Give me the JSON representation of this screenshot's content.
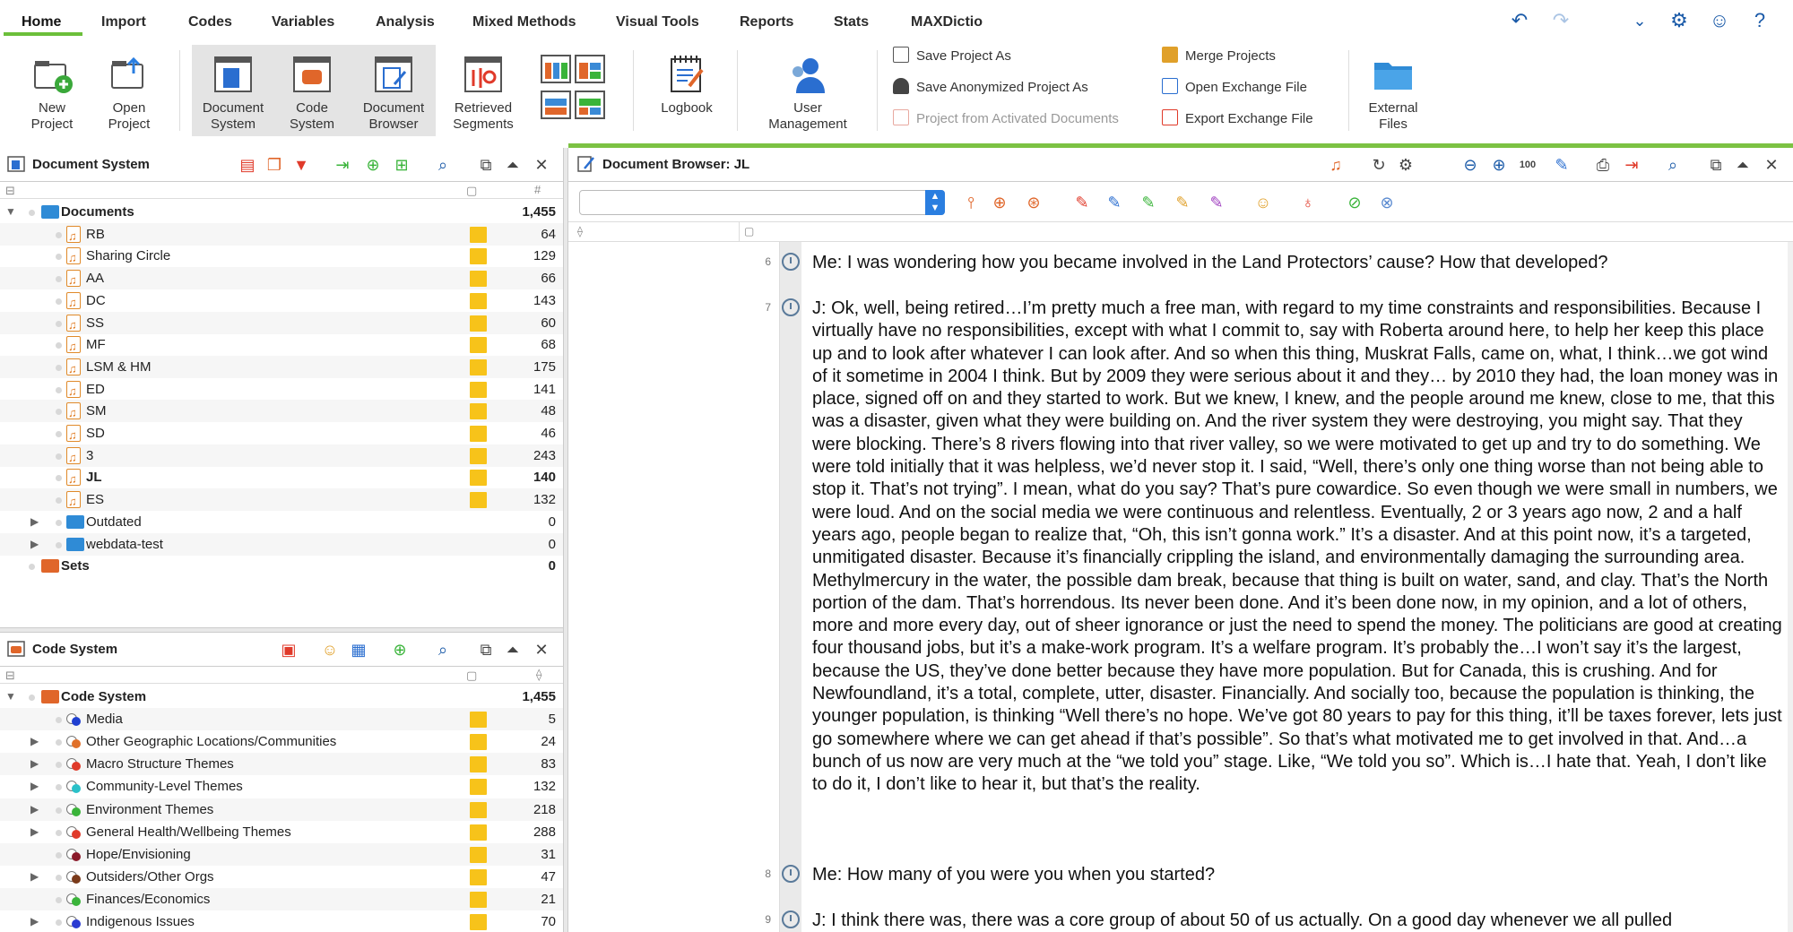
{
  "menu": {
    "tabs": [
      "Home",
      "Import",
      "Codes",
      "Variables",
      "Analysis",
      "Mixed Methods",
      "Visual Tools",
      "Reports",
      "Stats",
      "MAXDictio"
    ],
    "active": "Home"
  },
  "ribbon": {
    "new_project": "New\nProject",
    "open_project": "Open\nProject",
    "document_system": "Document\nSystem",
    "code_system": "Code\nSystem",
    "document_browser": "Document\nBrowser",
    "retrieved_segments": "Retrieved\nSegments",
    "logbook": "Logbook",
    "user_management": "User\nManagement",
    "save_project_as": "Save Project As",
    "save_anonymized": "Save Anonymized Project As",
    "project_from_activated": "Project from Activated Documents",
    "merge_projects": "Merge Projects",
    "open_exchange": "Open Exchange File",
    "export_exchange": "Export Exchange File",
    "external_files": "External\nFiles"
  },
  "document_system": {
    "title": "Document System",
    "col_count": "#",
    "root": {
      "label": "Documents",
      "count": "1,455"
    },
    "documents": [
      {
        "label": "RB",
        "count": "64"
      },
      {
        "label": "Sharing Circle",
        "count": "129"
      },
      {
        "label": "AA",
        "count": "66"
      },
      {
        "label": "DC",
        "count": "143"
      },
      {
        "label": "SS",
        "count": "60"
      },
      {
        "label": "MF",
        "count": "68"
      },
      {
        "label": "LSM & HM",
        "count": "175"
      },
      {
        "label": "ED",
        "count": "141"
      },
      {
        "label": "SM",
        "count": "48"
      },
      {
        "label": "SD",
        "count": "46"
      },
      {
        "label": "3",
        "count": "243"
      },
      {
        "label": "JL",
        "count": "140"
      },
      {
        "label": "ES",
        "count": "132"
      }
    ],
    "folders": [
      {
        "label": "Outdated",
        "count": "0"
      },
      {
        "label": "webdata-test",
        "count": "0"
      }
    ],
    "sets": {
      "label": "Sets",
      "count": "0"
    }
  },
  "code_system": {
    "title": "Code System",
    "root": {
      "label": "Code System",
      "count": "1,455"
    },
    "codes": [
      {
        "label": "Media",
        "count": "5",
        "color": "#1f3fd1",
        "expand": false
      },
      {
        "label": "Other Geographic Locations/Communities",
        "count": "24",
        "color": "#e0702a",
        "expand": true
      },
      {
        "label": "Macro Structure Themes",
        "count": "83",
        "color": "#e03a2a",
        "expand": true
      },
      {
        "label": "Community-Level Themes",
        "count": "132",
        "color": "#2ac0c8",
        "expand": true
      },
      {
        "label": "Environment Themes",
        "count": "218",
        "color": "#3ab43a",
        "expand": true
      },
      {
        "label": "General Health/Wellbeing Themes",
        "count": "288",
        "color": "#e03a2a",
        "expand": true
      },
      {
        "label": "Hope/Envisioning",
        "count": "31",
        "color": "#8a1a2a",
        "expand": false
      },
      {
        "label": "Outsiders/Other Orgs",
        "count": "47",
        "color": "#7a3a1a",
        "expand": true
      },
      {
        "label": "Finances/Economics",
        "count": "21",
        "color": "#3ab43a",
        "expand": false
      },
      {
        "label": "Indigenous Issues",
        "count": "70",
        "color": "#2a3ad1",
        "expand": true
      }
    ]
  },
  "document_browser": {
    "title": "Document Browser: JL",
    "paragraphs": [
      {
        "num": "6",
        "text": "Me: I was wondering how you became involved in the Land Protectors’ cause? How that developed?"
      },
      {
        "num": "7",
        "text": "J: Ok, well, being retired…I’m pretty much a free man, with regard to my time constraints and responsibilities. Because I virtually have no responsibilities, except with what I commit to, say with Roberta around here, to help her keep this place up and to look after whatever I can look after. And so when this thing, Muskrat Falls, came on, what, I think…we got wind of it sometime in 2004 I think. But by 2009 they were serious about it and they… by 2010 they had, the loan money was in place, signed off on and they started to work. But we knew, I knew, and the people around me knew, close to me, that this was a disaster, given what they were building on. And the river system they were destroying, you might say. That they were blocking. There’s 8 rivers flowing into that river valley, so we were motivated to get up and try to do something. We were told initially that it was helpless, we’d never stop it. I said, “Well, there’s only one thing worse than not being able to stop it. That’s not trying”. I mean, what do you say? That’s pure cowardice. So even though we were small in numbers, we were loud. And on the social media we were continuous and relentless. Eventually, 2 or 3 years ago now, 2 and a half years ago, people began to realize that, “Oh, this isn’t gonna work.” It’s a disaster. And at this point now, it’s a targeted, unmitigated disaster. Because it’s financially crippling the island, and environmentally damaging the surrounding area. Methylmercury in the water, the possible dam break, because that thing is built on water, sand, and clay. That’s the North portion of the dam. That’s horrendous. Its never been done. And it’s been done now, in my opinion, and a lot of others, more and more every day, out of sheer ignorance or just the need to spend the money. The politicians are good at creating four thousand jobs, but it’s a make-work program. It’s a welfare program. It’s probably the…I won’t say it’s the largest, because the US, they’ve done better because they have more population. But for Canada, this is crushing. And for Newfoundland, it’s a total, complete, utter, disaster. Financially. And socially too, because the population is thinking, the younger population, is thinking “Well there’s no hope. We’ve got 80 years to pay for this thing, it’ll be taxes forever, lets just go somewhere where we can get ahead if that’s possible”. So that’s what motivated me to get involved in that. And…a bunch of us now are very much at the “we told you” stage. Like, “We told you so”. Which is…I hate that. Yeah, I don’t like to do it, I don’t like to hear it, but that’s the reality."
      },
      {
        "num": "8",
        "text": "Me: How many of you were you when you started?"
      },
      {
        "num": "9",
        "text": "J: I think there was, there was a core group of about 50 of us actually. On a good day whenever we all pulled"
      }
    ]
  },
  "colors": {
    "accent_green": "#7cc243",
    "code_swatch": "#f7c31a",
    "folder_blue": "#2f8bd6"
  }
}
